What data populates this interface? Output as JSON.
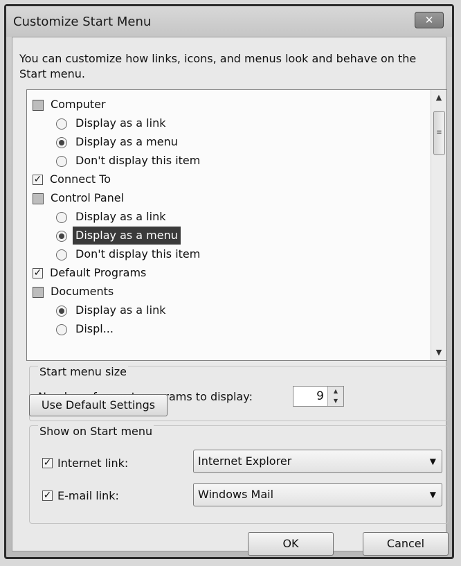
{
  "window": {
    "title": "Customize Start Menu",
    "close_label": "✕"
  },
  "intro_text": "You can customize how links, icons, and menus look and behave on the Start menu.",
  "tree": {
    "rows": [
      {
        "kind": "category",
        "icon": "computer-icon",
        "label": "Computer"
      },
      {
        "kind": "radio",
        "checked": false,
        "label": "Display as a link"
      },
      {
        "kind": "radio",
        "checked": true,
        "label": "Display as a menu"
      },
      {
        "kind": "radio",
        "checked": false,
        "label": "Don't display this item"
      },
      {
        "kind": "checkbox",
        "checked": true,
        "label": "Connect To"
      },
      {
        "kind": "category",
        "icon": "control-panel-icon",
        "label": "Control Panel"
      },
      {
        "kind": "radio",
        "checked": false,
        "label": "Display as a link"
      },
      {
        "kind": "radio",
        "checked": true,
        "selected": true,
        "label": "Display as a menu"
      },
      {
        "kind": "radio",
        "checked": false,
        "label": "Don't display this item"
      },
      {
        "kind": "checkbox",
        "checked": true,
        "label": "Default Programs"
      },
      {
        "kind": "category",
        "icon": "documents-icon",
        "label": "Documents"
      },
      {
        "kind": "radio",
        "checked": true,
        "label": "Display as a link"
      },
      {
        "kind": "radio",
        "checked": false,
        "label": "Displ..."
      }
    ]
  },
  "start_menu_size": {
    "title": "Start menu size",
    "recent_programs_label": "Number of recent programs to display:",
    "recent_programs_value": "9"
  },
  "use_default_settings_label": "Use Default Settings",
  "show_on_start_menu": {
    "title": "Show on Start menu",
    "internet_link_label": "Internet link:",
    "internet_link_checked": true,
    "internet_link_value": "Internet Explorer",
    "email_link_label": "E-mail link:",
    "email_link_checked": true,
    "email_link_value": "Windows Mail"
  },
  "buttons": {
    "ok": "OK",
    "cancel": "Cancel"
  }
}
